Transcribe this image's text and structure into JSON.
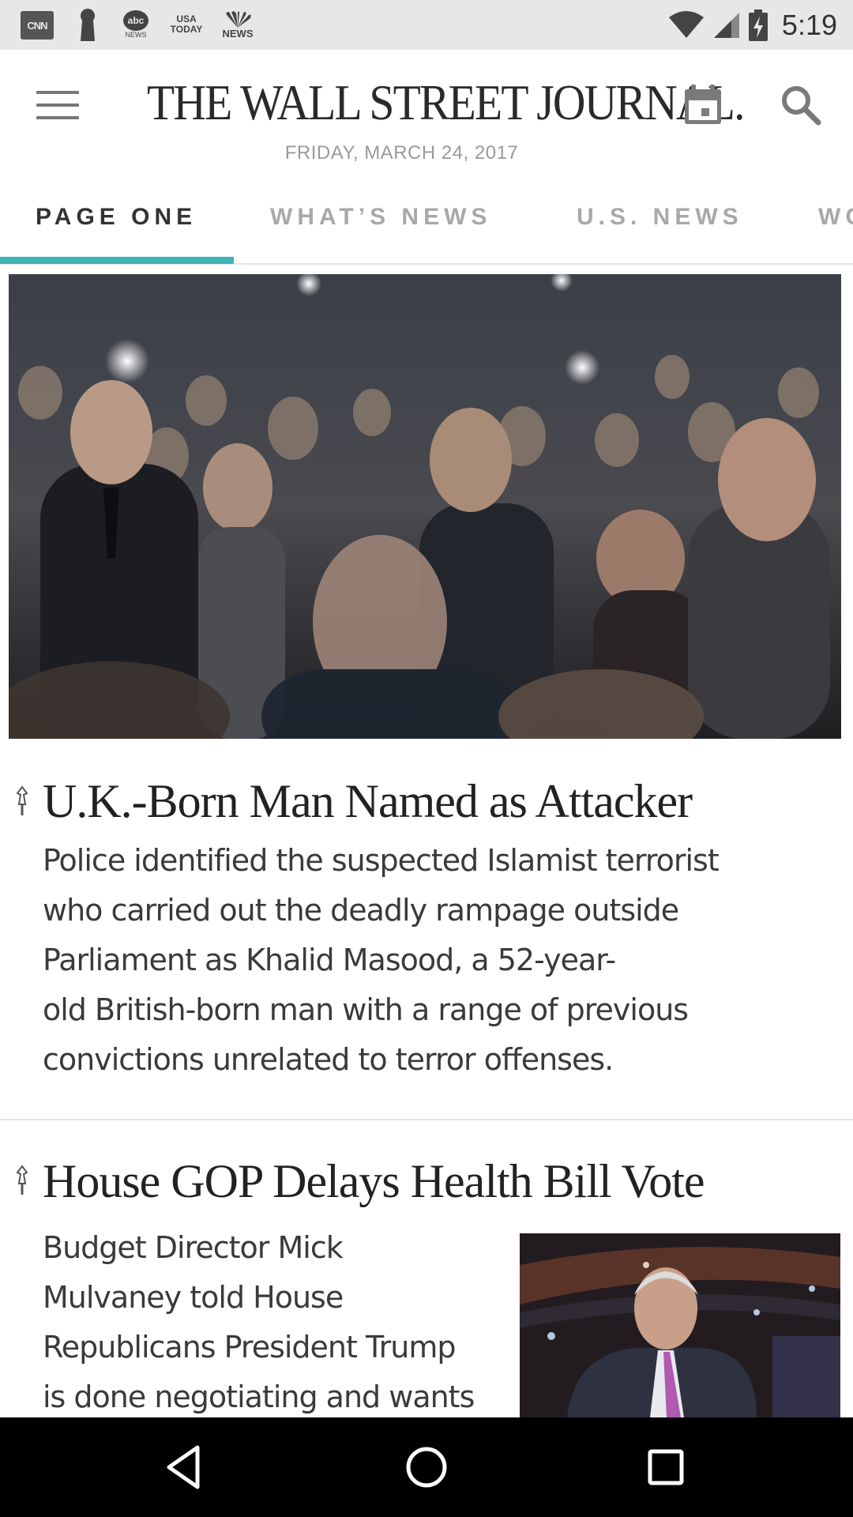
{
  "status_bar": {
    "notifications": [
      {
        "icon": "cnn-icon",
        "label": "CNN"
      },
      {
        "icon": "keyhole-icon"
      },
      {
        "icon": "abc-news-icon",
        "label": "abc",
        "sub": "NEWS"
      },
      {
        "icon": "usa-today-icon",
        "line1": "USA",
        "line2": "TODAY"
      },
      {
        "icon": "nbc-news-icon",
        "label": "NEWS"
      }
    ],
    "wifi": "wifi-icon",
    "signal": "signal-icon",
    "battery": "battery-charging-icon",
    "time": "5:19"
  },
  "header": {
    "menu_icon": "hamburger-menu-icon",
    "masthead": "THE WALL STREET JOURNAL.",
    "calendar_icon": "calendar-icon",
    "search_icon": "search-icon",
    "date": "FRIDAY, MARCH 24, 2017"
  },
  "tabs": [
    {
      "label": "PAGE ONE",
      "active": true
    },
    {
      "label": "WHAT’S NEWS",
      "active": false
    },
    {
      "label": "U.S. NEWS",
      "active": false
    },
    {
      "label": "WO",
      "active": false
    }
  ],
  "colors": {
    "accent": "#3fb4b4",
    "status_bar": "#e7e7e7",
    "nav_bar": "#000000"
  },
  "articles": [
    {
      "headline": "U.K.-Born Man Named as Attacker",
      "summary": [
        "Police identified the suspected Islamist terrorist",
        "who carried out the deadly rampage outside",
        "Parliament as Khalid Masood, a 52-year-",
        "old British-born man with a range of previous",
        "convictions unrelated to terror offenses."
      ],
      "image": "crowd-vigil-photo"
    },
    {
      "headline": "House GOP Delays Health Bill Vote",
      "summary": [
        "Budget Director Mick",
        "Mulvaney told House",
        "Republicans President Trump",
        "is done negotiating and wants"
      ],
      "image": "politician-photo"
    }
  ],
  "nav_bar": {
    "back": "back-icon",
    "home": "home-icon",
    "recents": "recents-icon"
  }
}
